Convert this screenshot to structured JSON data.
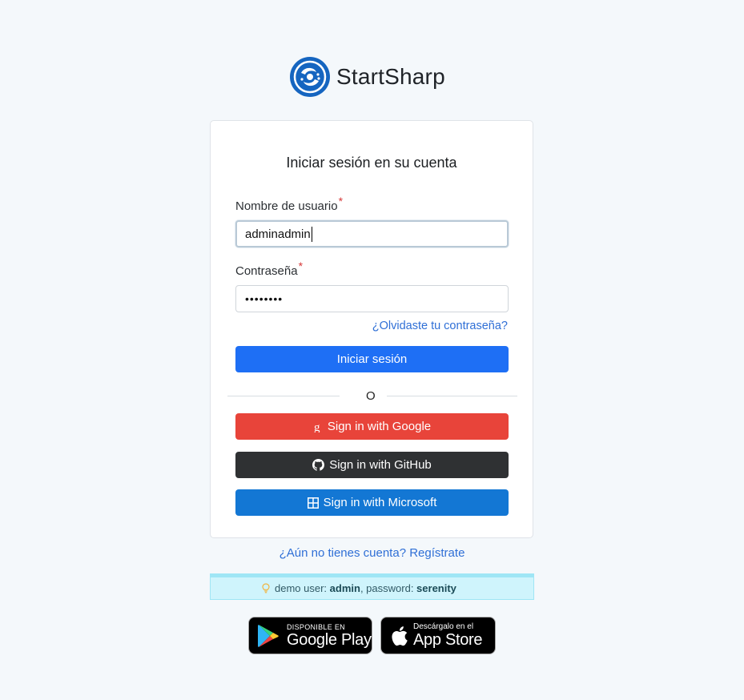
{
  "brand": {
    "name": "StartSharp",
    "logo_icon": "startsharp-logo-icon",
    "color": "#1565c0"
  },
  "login": {
    "title": "Iniciar sesión en su cuenta",
    "username_label": "Nombre de usuario",
    "username_value": "adminadmin",
    "password_label": "Contraseña",
    "password_value": "••••••••",
    "required_mark": "*",
    "forgot_link": "¿Olvidaste tu contraseña?",
    "submit_label": "Iniciar sesión",
    "or_text": "O"
  },
  "social": {
    "google": {
      "label": "Sign in with Google",
      "icon": "google-icon",
      "color": "#e8443a"
    },
    "github": {
      "label": "Sign in with GitHub",
      "icon": "github-icon",
      "color": "#2f3133"
    },
    "microsoft": {
      "label": "Sign in with Microsoft",
      "icon": "microsoft-icon",
      "color": "#1377d4"
    }
  },
  "register_link": "¿Aún no tienes cuenta? Regístrate",
  "demo": {
    "icon": "lightbulb-icon",
    "prefix": "demo user: ",
    "user": "admin",
    "middle": ", password: ",
    "password": "serenity"
  },
  "stores": {
    "google_play": {
      "small": "DISPONIBLE EN",
      "big": "Google Play"
    },
    "app_store": {
      "small": "Descárgalo en el",
      "big": "App Store"
    }
  }
}
